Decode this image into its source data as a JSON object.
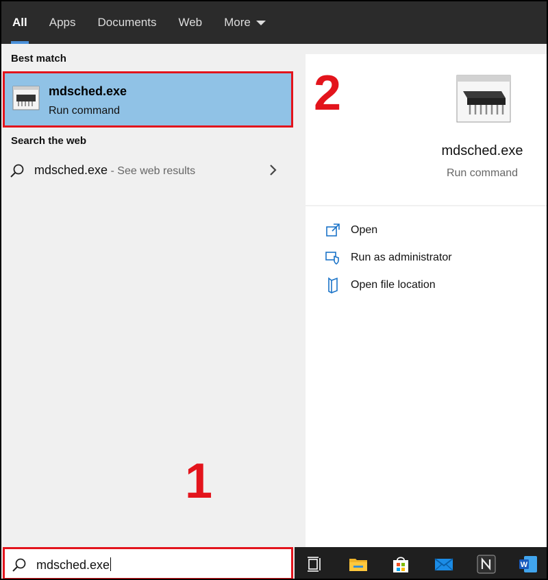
{
  "tabs": [
    {
      "label": "All"
    },
    {
      "label": "Apps"
    },
    {
      "label": "Documents"
    },
    {
      "label": "Web"
    },
    {
      "label": "More"
    }
  ],
  "left": {
    "best_match_title": "Best match",
    "best_match": {
      "name": "mdsched.exe",
      "subtitle": "Run command"
    },
    "search_web_title": "Search the web",
    "web_result": {
      "query": "mdsched.exe",
      "hint": " - See web results"
    }
  },
  "search": {
    "value": "mdsched.exe"
  },
  "annotations": {
    "one": "1",
    "two": "2"
  },
  "detail": {
    "name": "mdsched.exe",
    "subtitle": "Run command",
    "actions": [
      {
        "label": "Open",
        "icon": "open-icon"
      },
      {
        "label": "Run as administrator",
        "icon": "shield-icon"
      },
      {
        "label": "Open file location",
        "icon": "folder-location-icon"
      }
    ]
  },
  "taskbar": {
    "icons": [
      "task-view-icon",
      "file-explorer-icon",
      "store-icon",
      "mail-icon",
      "notion-icon",
      "word-icon"
    ]
  },
  "colors": {
    "accent": "#4a90d9",
    "highlight": "#90c2e6",
    "annotation": "#e3141c",
    "taskbar": "#1f1f1f"
  }
}
